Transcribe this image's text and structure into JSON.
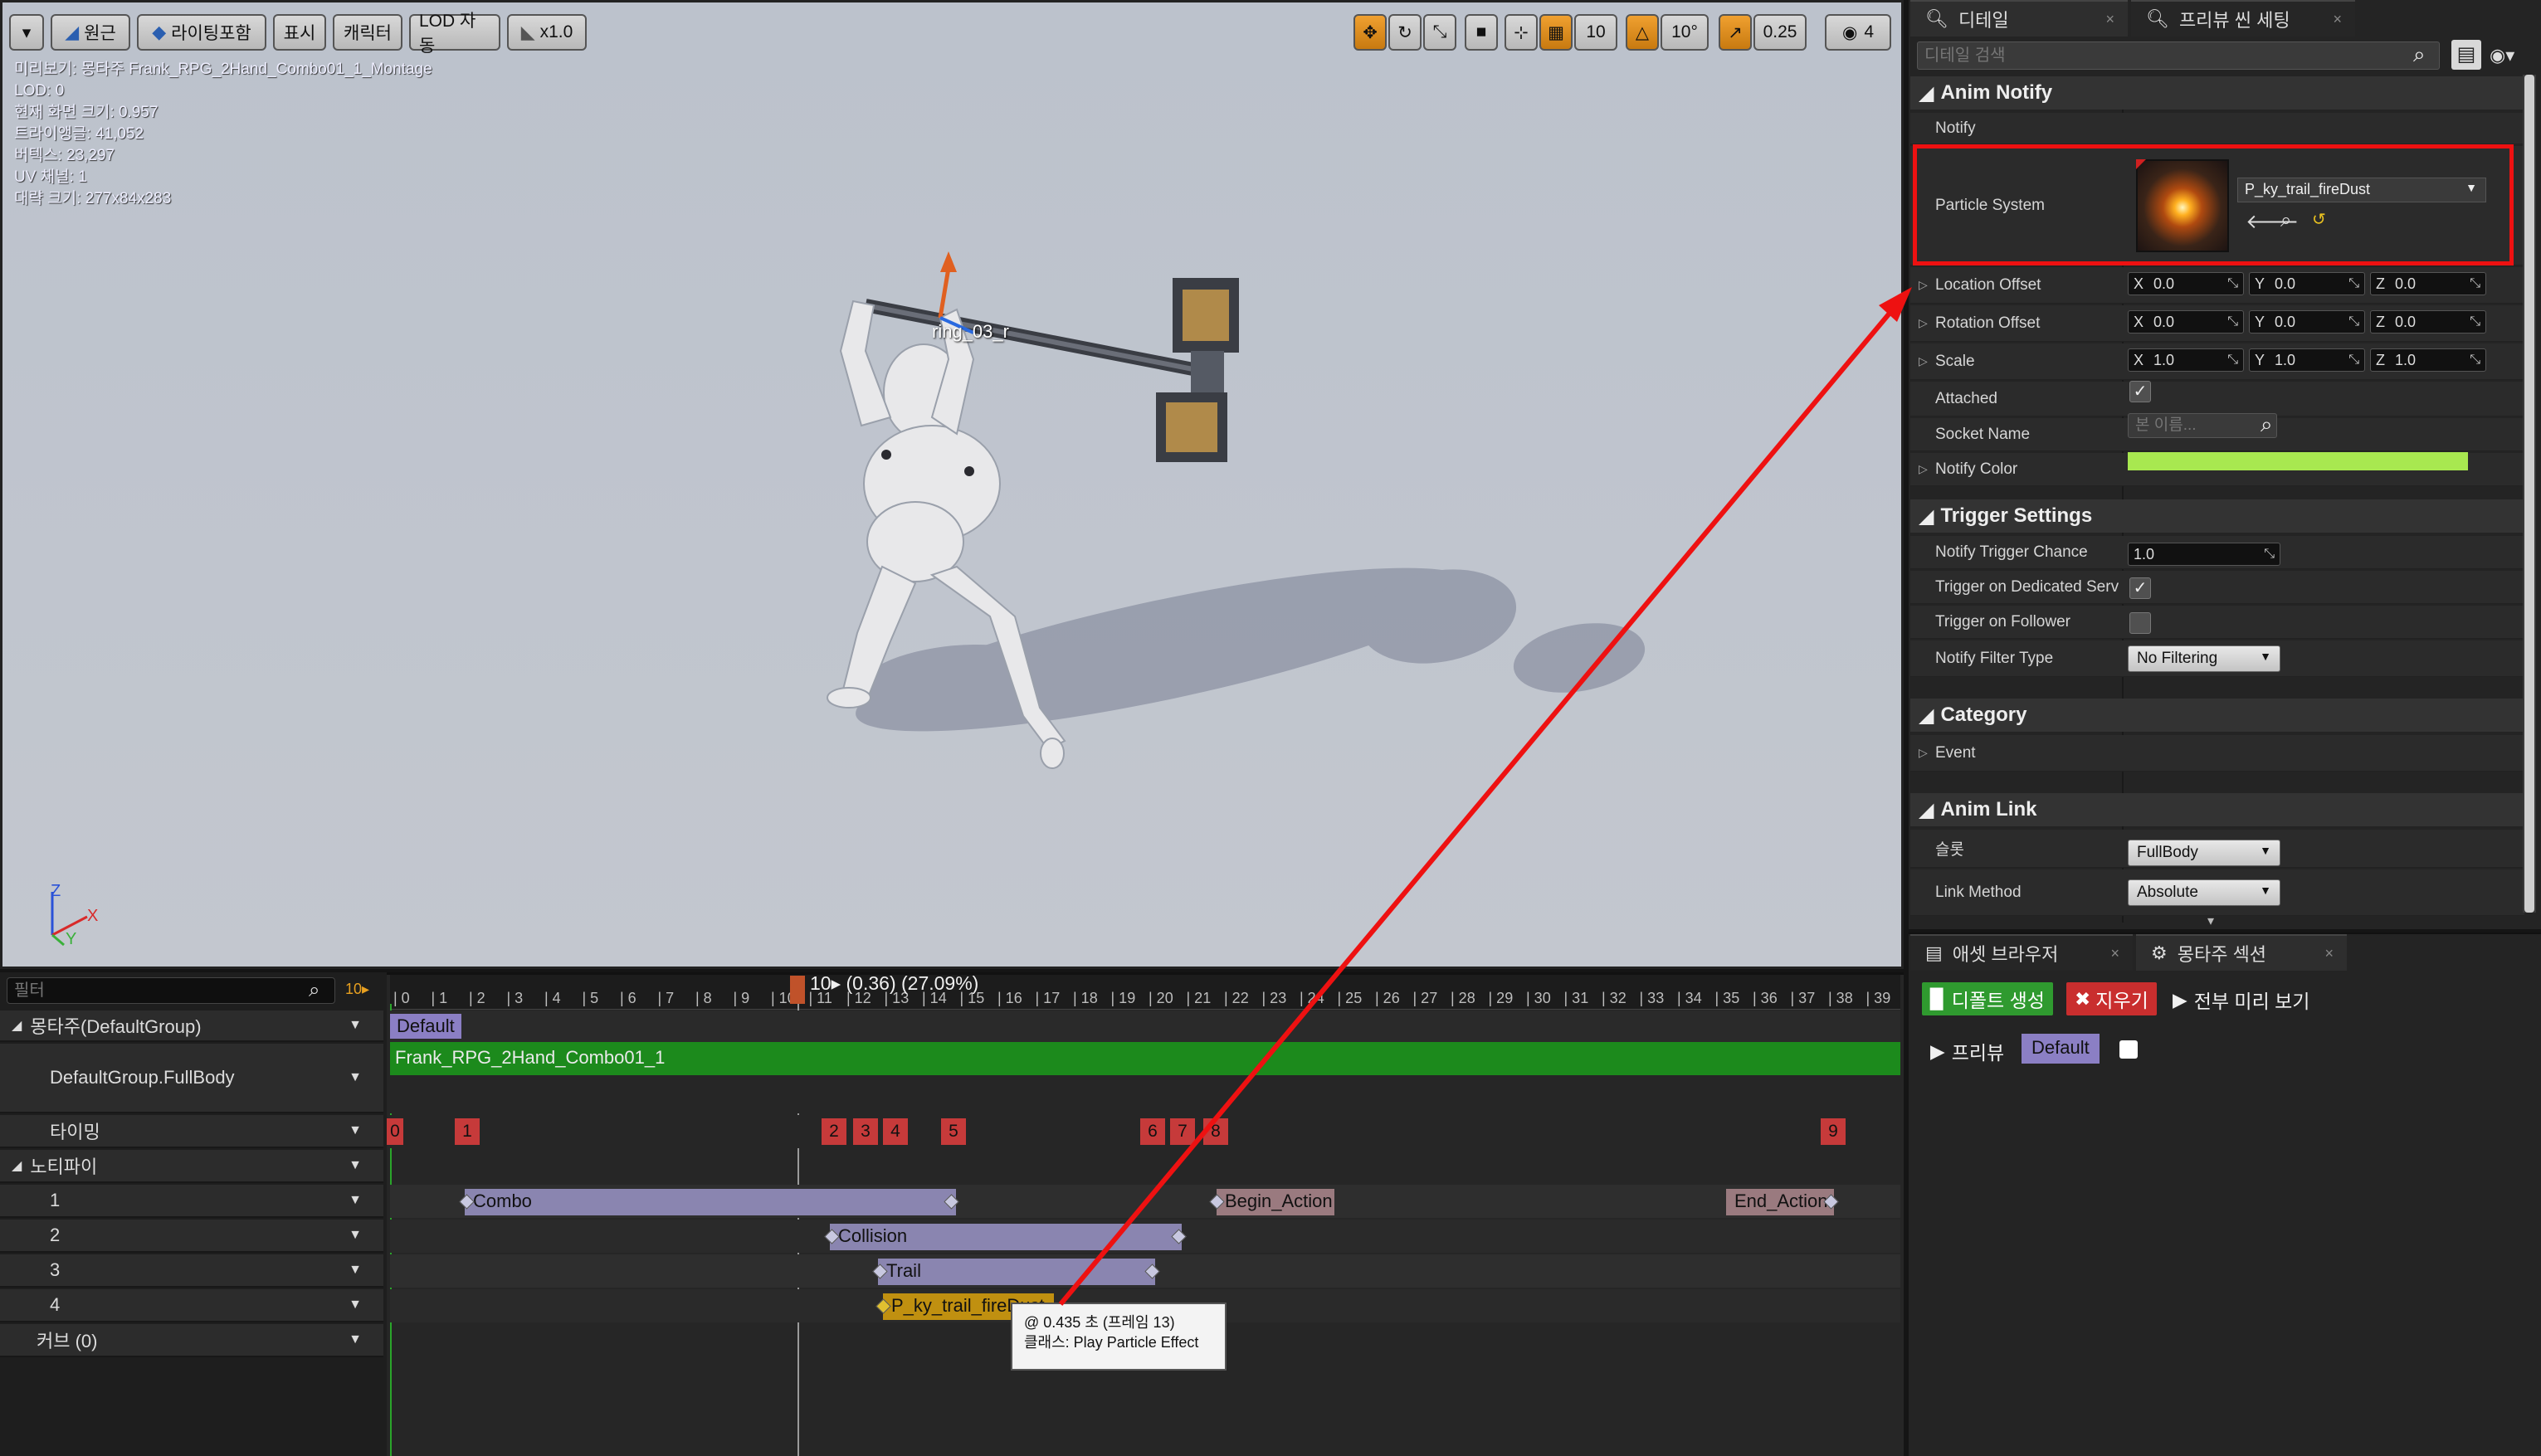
{
  "viewport": {
    "toolbar": {
      "menu_icon": "chevron-down-icon",
      "perspective_label": "원근",
      "lighting_label": "라이팅포함",
      "show_label": "표시",
      "character_label": "캐릭터",
      "lod_label": "LOD 자동",
      "speed_label": "x1.0",
      "grid_snap_value": "10",
      "rotation_snap_value": "10°",
      "scale_snap_value": "0.25",
      "camera_speed_value": "4"
    },
    "stats": [
      "미리보기: 몽타주 Frank_RPG_2Hand_Combo01_1_Montage",
      "LOD: 0",
      "현재 화면 크기: 0.957",
      "트라이앵글: 41,052",
      "버텍스: 23,297",
      "UV 채널: 1",
      "대략 크기: 277x84x283"
    ],
    "bone_label": "ring_03_r",
    "axis": {
      "z": "Z",
      "x": "X",
      "y": "Y"
    }
  },
  "timeline": {
    "filter_placeholder": "필터",
    "fps_label": "10▸",
    "scrub_text": "10▸ (0.36) (27.09%)",
    "ruler_ticks": [
      "0",
      "1",
      "2",
      "3",
      "4",
      "5",
      "6",
      "7",
      "8",
      "9",
      "10",
      "11",
      "12",
      "13",
      "14",
      "15",
      "16",
      "17",
      "18",
      "19",
      "20",
      "21",
      "22",
      "23",
      "24",
      "25",
      "26",
      "27",
      "28",
      "29",
      "30",
      "31",
      "32",
      "33",
      "34",
      "35",
      "36",
      "37",
      "38",
      "39"
    ],
    "rows": {
      "montage_group": "몽타주(DefaultGroup)",
      "slot": "DefaultGroup.FullBody",
      "timing": "타이밍",
      "notifies": "노티파이",
      "track_1": "1",
      "track_2": "2",
      "track_3": "3",
      "track_4": "4",
      "curves": "커브  (0)"
    },
    "section_label": "Default",
    "montage_anim": "Frank_RPG_2Hand_Combo01_1",
    "timing_markers": [
      "0",
      "1",
      "2",
      "3",
      "4",
      "5",
      "6",
      "7",
      "8",
      "9"
    ],
    "notifies": {
      "combo": "Combo",
      "begin_action": "Begin_Action",
      "end_action": "End_Action",
      "collision": "Collision",
      "trail": "Trail",
      "fire_dust": "P_ky_trail_fireDust"
    },
    "tooltip": {
      "line1": "@ 0.435 초 (프레임 13)",
      "line2": "클래스: Play Particle Effect"
    }
  },
  "details": {
    "tab_details": "디테일",
    "tab_preview_settings": "프리뷰 씬 세팅",
    "search_placeholder": "디테일 검색",
    "anim_notify": {
      "header": "Anim Notify",
      "notify_label": "Notify",
      "particle_system_label": "Particle System",
      "particle_system_value": "P_ky_trail_fireDust",
      "location_offset_label": "Location Offset",
      "location_offset": {
        "x": "0.0",
        "y": "0.0",
        "z": "0.0"
      },
      "rotation_offset_label": "Rotation Offset",
      "rotation_offset": {
        "x": "0.0",
        "y": "0.0",
        "z": "0.0"
      },
      "scale_label": "Scale",
      "scale": {
        "x": "1.0",
        "y": "1.0",
        "z": "1.0"
      },
      "attached_label": "Attached",
      "attached": true,
      "socket_name_label": "Socket Name",
      "socket_name_placeholder": "본 이름...",
      "notify_color_label": "Notify Color",
      "notify_color": "#a8e850"
    },
    "trigger_settings": {
      "header": "Trigger Settings",
      "trigger_chance_label": "Notify Trigger Chance",
      "trigger_chance": "1.0",
      "dedicated_server_label": "Trigger on Dedicated Serv",
      "dedicated_server": true,
      "follower_label": "Trigger on Follower",
      "follower": false,
      "filter_type_label": "Notify Filter Type",
      "filter_type": "No Filtering"
    },
    "category": {
      "header": "Category",
      "event_label": "Event"
    },
    "anim_link": {
      "header": "Anim Link",
      "slot_label": "슬롯",
      "slot_value": "FullBody",
      "link_method_label": "Link Method",
      "link_method_value": "Absolute"
    }
  },
  "bottom_panel": {
    "tab_asset_browser": "애셋 브라우저",
    "tab_montage_sections": "몽타주 섹션",
    "create_default_label": "디폴트 생성",
    "clear_label": "지우기",
    "preview_all_label": "전부 미리 보기",
    "preview_label": "프리뷰",
    "default_section": "Default"
  }
}
